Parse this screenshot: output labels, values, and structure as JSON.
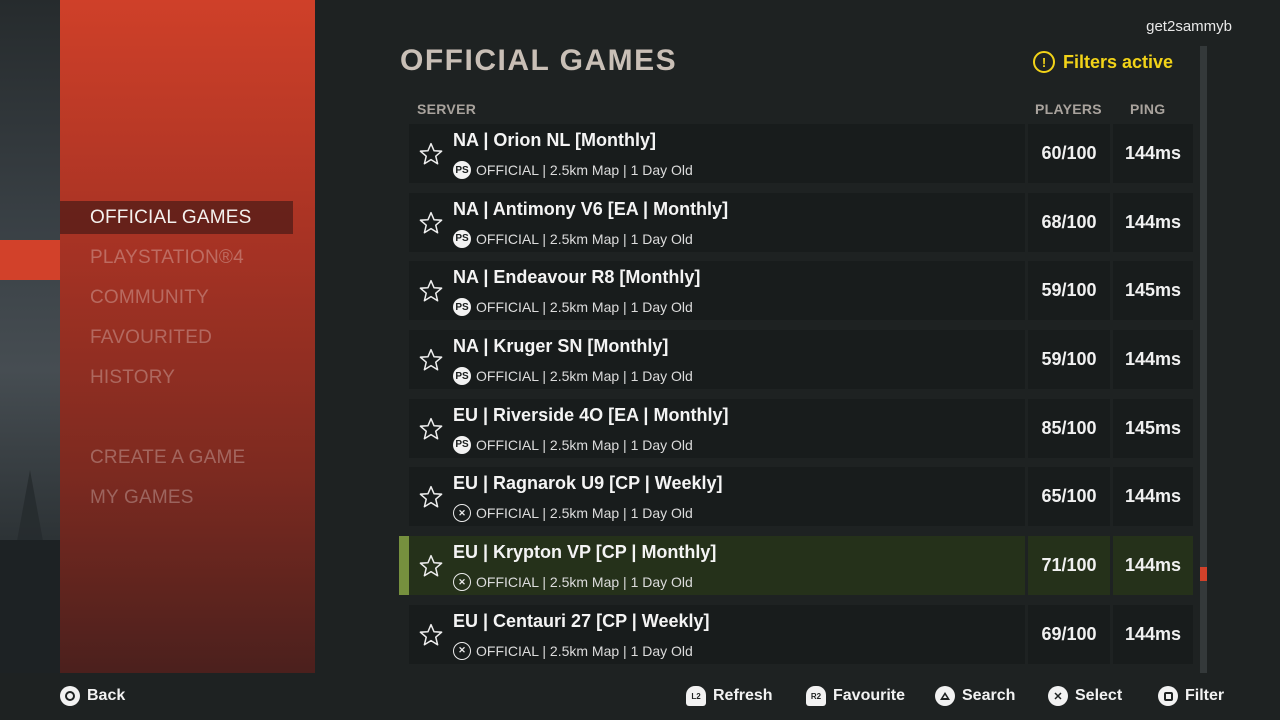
{
  "user": {
    "name": "get2sammyb"
  },
  "header": {
    "title": "OFFICIAL GAMES",
    "filters_label": "Filters active",
    "filters_icon": "exclamation-circle-icon",
    "accent_color": "#f2d318"
  },
  "sidebar": {
    "accent_color": "#d2412a",
    "items": [
      {
        "label": "OFFICIAL GAMES",
        "active": true
      },
      {
        "label": "PLAYSTATION®4",
        "active": false
      },
      {
        "label": "COMMUNITY",
        "active": false
      },
      {
        "label": "FAVOURITED",
        "active": false
      },
      {
        "label": "HISTORY",
        "active": false
      },
      {
        "label": "CREATE A GAME",
        "active": false
      },
      {
        "label": "MY GAMES",
        "active": false
      }
    ]
  },
  "table": {
    "columns": {
      "server": "SERVER",
      "players": "PLAYERS",
      "ping": "PING"
    },
    "rows": [
      {
        "name": "NA | Orion NL [Monthly]",
        "platform": "playstation",
        "platform_glyph": "PS",
        "meta": "OFFICIAL | 2.5km Map | 1 Day Old",
        "players": "60/100",
        "ping": "144ms",
        "selected": false
      },
      {
        "name": "NA | Antimony V6 [EA | Monthly]",
        "platform": "playstation",
        "platform_glyph": "PS",
        "meta": "OFFICIAL | 2.5km Map | 1 Day Old",
        "players": "68/100",
        "ping": "144ms",
        "selected": false
      },
      {
        "name": "NA | Endeavour R8 [Monthly]",
        "platform": "playstation",
        "platform_glyph": "PS",
        "meta": "OFFICIAL | 2.5km Map | 1 Day Old",
        "players": "59/100",
        "ping": "145ms",
        "selected": false
      },
      {
        "name": "NA | Kruger SN [Monthly]",
        "platform": "playstation",
        "platform_glyph": "PS",
        "meta": "OFFICIAL | 2.5km Map | 1 Day Old",
        "players": "59/100",
        "ping": "144ms",
        "selected": false
      },
      {
        "name": "EU | Riverside 4O [EA | Monthly]",
        "platform": "playstation",
        "platform_glyph": "PS",
        "meta": "OFFICIAL | 2.5km Map | 1 Day Old",
        "players": "85/100",
        "ping": "145ms",
        "selected": false
      },
      {
        "name": "EU | Ragnarok U9 [CP | Weekly]",
        "platform": "crossplay",
        "platform_glyph": "✕",
        "meta": "OFFICIAL | 2.5km Map | 1 Day Old",
        "players": "65/100",
        "ping": "144ms",
        "selected": false
      },
      {
        "name": "EU | Krypton VP [CP | Monthly]",
        "platform": "crossplay",
        "platform_glyph": "✕",
        "meta": "OFFICIAL | 2.5km Map | 1 Day Old",
        "players": "71/100",
        "ping": "144ms",
        "selected": true
      },
      {
        "name": "EU | Centauri 27 [CP | Weekly]",
        "platform": "crossplay",
        "platform_glyph": "✕",
        "meta": "OFFICIAL | 2.5km Map | 1 Day Old",
        "players": "69/100",
        "ping": "144ms",
        "selected": false
      }
    ]
  },
  "scroll": {
    "position_fraction": 0.85
  },
  "footer": {
    "back": {
      "label": "Back",
      "button": "circle"
    },
    "refresh": {
      "label": "Refresh",
      "button": "L2"
    },
    "favourite": {
      "label": "Favourite",
      "button": "R2"
    },
    "search": {
      "label": "Search",
      "button": "triangle"
    },
    "select": {
      "label": "Select",
      "button": "cross"
    },
    "filter": {
      "label": "Filter",
      "button": "square"
    }
  }
}
